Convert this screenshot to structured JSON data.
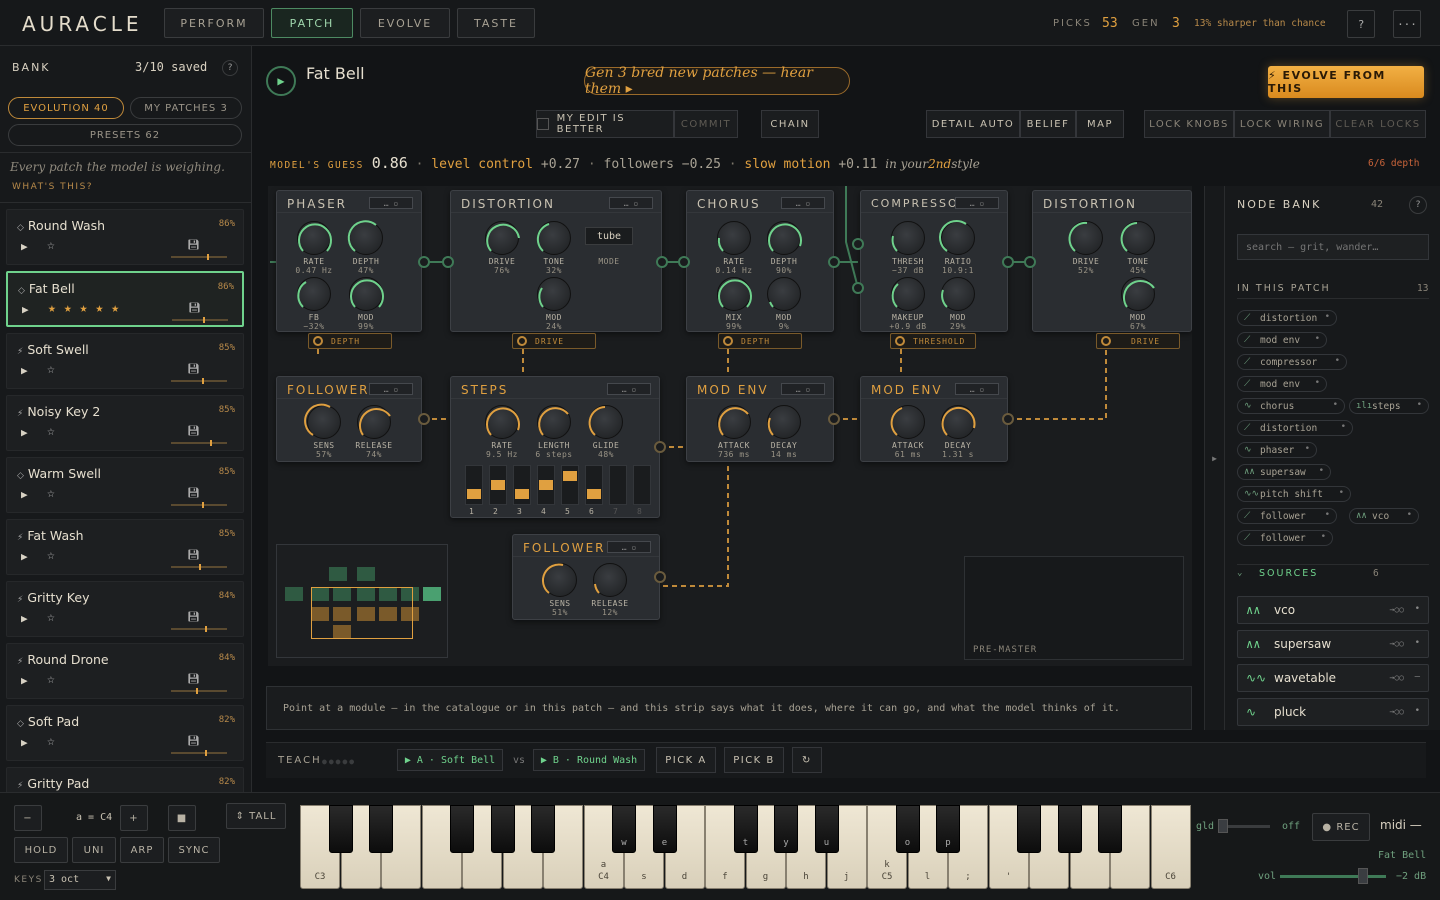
{
  "app": {
    "logo": "AURACLE",
    "tabs": [
      "PERFORM",
      "PATCH",
      "EVOLVE",
      "TASTE"
    ],
    "active_tab": "PATCH",
    "picks_label": "PICKS",
    "picks": "53",
    "gen_label": "GEN",
    "gen": "3",
    "sharper": "13% sharper than chance",
    "help": "?",
    "more": "···"
  },
  "bank": {
    "title": "BANK",
    "saved": "3/10 saved",
    "help": "?",
    "evolution": "EVOLUTION",
    "evolution_count": "40",
    "my_patches": "MY PATCHES",
    "my_patches_count": "3",
    "presets": "PRESETS 62",
    "hint": "Every patch the model is weighing.",
    "whats_this": "WHAT'S THIS?",
    "patches": [
      {
        "name": "Round Wash",
        "pct": "86%",
        "icon": "◇",
        "stars": "☆",
        "rated": false,
        "level": 0.65
      },
      {
        "name": "Fat Bell",
        "pct": "86%",
        "icon": "◇",
        "stars": "★★★★★",
        "rated": true,
        "level": 0.55
      },
      {
        "name": "Soft Swell",
        "pct": "85%",
        "icon": "⚡",
        "stars": "☆",
        "rated": false,
        "level": 0.55
      },
      {
        "name": "Noisy Key 2",
        "pct": "85%",
        "icon": "⚡",
        "stars": "☆",
        "rated": false,
        "level": 0.7
      },
      {
        "name": "Warm Swell",
        "pct": "85%",
        "icon": "◇",
        "stars": "☆",
        "rated": false,
        "level": 0.55
      },
      {
        "name": "Fat Wash",
        "pct": "85%",
        "icon": "⚡",
        "stars": "☆",
        "rated": false,
        "level": 0.5
      },
      {
        "name": "Gritty Key",
        "pct": "84%",
        "icon": "⚡",
        "stars": "☆",
        "rated": false,
        "level": 0.6
      },
      {
        "name": "Round Drone",
        "pct": "84%",
        "icon": "⚡",
        "stars": "☆",
        "rated": false,
        "level": 0.45
      },
      {
        "name": "Soft Pad",
        "pct": "82%",
        "icon": "◇",
        "stars": "☆",
        "rated": false,
        "level": 0.6
      },
      {
        "name": "Gritty Pad",
        "pct": "82%",
        "icon": "⚡",
        "stars": "",
        "rated": false,
        "level": 0.5
      }
    ]
  },
  "patch": {
    "name": "Fat Bell",
    "banner": "Gen 3 bred new patches — hear them ▸",
    "evolve": "⚡ EVOLVE FROM THIS",
    "my_edit": "MY EDIT IS BETTER",
    "commit": "COMMIT",
    "chain": "CHAIN",
    "detail_auto": "DETAIL AUTO",
    "belief": "BELIEF",
    "map": "MAP",
    "lock_knobs": "LOCK KNOBS",
    "lock_wiring": "LOCK WIRING",
    "clear_locks": "CLEAR LOCKS",
    "guess_label": "MODEL'S GUESS",
    "guess_value": "0.86",
    "t1": "level control",
    "t1v": "+0.27",
    "t2": "followers",
    "t2v": "−0.25",
    "t3": "slow motion",
    "t3v": "+0.11",
    "style_pre": "in your",
    "style_ord": "2nd",
    "style_post": "style",
    "depth": "6/6 depth",
    "strip": "Point at a module — in the catalogue or in this patch — and this strip says what it does, where it can go, and what the model thinks of it.",
    "pre_master": "PRE-MASTER"
  },
  "modules": {
    "phaser": {
      "title": "PHASER",
      "k1": "RATE",
      "v1": "0.47 Hz",
      "k2": "DEPTH",
      "v2": "47%",
      "k3": "FB",
      "v3": "−32%",
      "k4": "MOD",
      "v4": "99%",
      "tag": "DEPTH"
    },
    "dist1": {
      "title": "DISTORTION",
      "k1": "DRIVE",
      "v1": "76%",
      "k2": "TONE",
      "v2": "32%",
      "mode": "tube",
      "mode_label": "MODE",
      "k3": "MOD",
      "v3": "24%",
      "tag": "DRIVE"
    },
    "chorus": {
      "title": "CHORUS",
      "k1": "RATE",
      "v1": "0.14 Hz",
      "k2": "DEPTH",
      "v2": "90%",
      "k3": "MIX",
      "v3": "99%",
      "k4": "MOD",
      "v4": "9%",
      "tag": "DEPTH"
    },
    "comp": {
      "title": "COMPRESSOR",
      "k1": "THRESH",
      "v1": "−37 dB",
      "k2": "RATIO",
      "v2": "10.9:1",
      "k3": "MAKEUP",
      "v3": "+0.9 dB",
      "k4": "MOD",
      "v4": "29%",
      "tag": "THRESHOLD"
    },
    "dist2": {
      "title": "DISTORTION",
      "k1": "DRIVE",
      "v1": "52%",
      "k2": "TONE",
      "v2": "45%",
      "k3": "MOD",
      "v3": "67%",
      "tag": "DRIVE"
    },
    "follower1": {
      "title": "FOLLOWER",
      "k1": "SENS",
      "v1": "57%",
      "k2": "RELEASE",
      "v2": "74%"
    },
    "steps": {
      "title": "STEPS",
      "k1": "RATE",
      "v1": "9.5 Hz",
      "k2": "LENGTH",
      "v2": "6 steps",
      "k3": "GLIDE",
      "v3": "48%",
      "nums": [
        "1",
        "2",
        "3",
        "4",
        "5",
        "6",
        "7",
        "8"
      ]
    },
    "modenv1": {
      "title": "MOD ENV",
      "k1": "ATTACK",
      "v1": "736 ms",
      "k2": "DECAY",
      "v2": "14 ms"
    },
    "modenv2": {
      "title": "MOD ENV",
      "k1": "ATTACK",
      "v1": "61 ms",
      "k2": "DECAY",
      "v2": "1.31 s"
    },
    "follower2": {
      "title": "FOLLOWER",
      "k1": "SENS",
      "v1": "51%",
      "k2": "RELEASE",
      "v2": "12%"
    }
  },
  "nodebank": {
    "title": "NODE BANK",
    "count": "42",
    "help": "?",
    "search_placeholder": "search — grit, wander…",
    "in_patch": "IN THIS PATCH",
    "in_patch_count": "13",
    "chips": [
      "distortion",
      "mod env",
      "compressor",
      "mod env",
      "chorus",
      "steps",
      "distortion",
      "phaser",
      "supersaw",
      "pitch shift",
      "follower",
      "vco",
      "follower"
    ],
    "sources_label": "SOURCES",
    "sources_count": "6",
    "sources": [
      "vco",
      "supersaw",
      "wavetable",
      "pluck"
    ]
  },
  "teach": {
    "label": "TEACH",
    "a": "▶ A · Soft Bell",
    "vs": "vs",
    "b": "▶ B · Round Wash",
    "pick_a": "PICK A",
    "pick_b": "PICK B",
    "refresh": "↻"
  },
  "keyboard": {
    "minus": "−",
    "octave": "a = C4",
    "plus": "+",
    "stop": "■",
    "tall": "⇕ TALL",
    "hold": "HOLD",
    "uni": "UNI",
    "arp": "ARP",
    "sync": "SYNC",
    "keys_label": "KEYS",
    "keys_value": "3 oct",
    "gld": "gld",
    "off": "off",
    "rec": "● REC",
    "midi": "midi —",
    "patch": "Fat Bell",
    "vol": "vol",
    "vol_value": "−2 dB",
    "white": [
      "C3",
      "",
      "",
      "",
      "",
      "",
      "",
      "C4",
      "s",
      "d",
      "f",
      "g",
      "h",
      "j",
      "C5",
      "l",
      ";",
      "'",
      "",
      "",
      "",
      "C6"
    ],
    "white_top": [
      "",
      "",
      "",
      "",
      "",
      "",
      "",
      "a",
      "",
      "",
      "",
      "",
      "",
      "",
      "k",
      "",
      "",
      "",
      "",
      "",
      "",
      ""
    ],
    "black": [
      "",
      "",
      "",
      "",
      "",
      "w",
      "e",
      "t",
      "y",
      "u",
      "o",
      "p",
      "",
      "",
      "",
      ""
    ]
  }
}
